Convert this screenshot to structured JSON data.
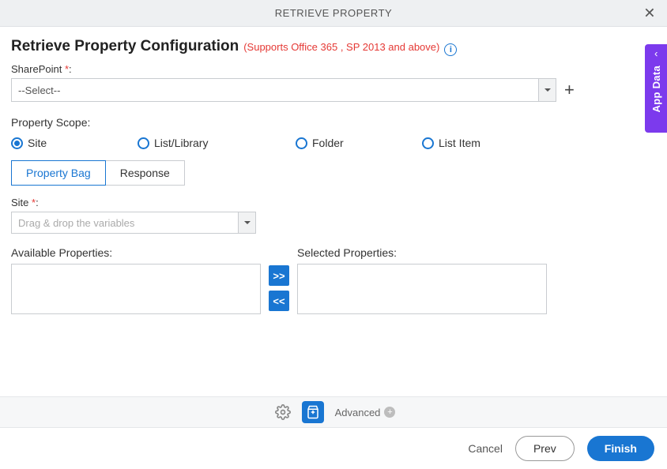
{
  "titleBar": {
    "title": "RETRIEVE PROPERTY"
  },
  "heading": {
    "main": "Retrieve Property Configuration",
    "note": "(Supports Office 365 , SP 2013 and above)"
  },
  "sharepoint": {
    "label": "SharePoint",
    "selected": "--Select--"
  },
  "scope": {
    "label": "Property Scope:",
    "options": [
      "Site",
      "List/Library",
      "Folder",
      "List Item"
    ],
    "selected": "Site"
  },
  "tabs": {
    "items": [
      "Property Bag",
      "Response"
    ],
    "active": "Property Bag"
  },
  "site": {
    "label": "Site",
    "placeholder": "Drag & drop the variables"
  },
  "dual": {
    "availableLabel": "Available Properties:",
    "selectedLabel": "Selected Properties:",
    "addAll": ">>",
    "removeAll": "<<"
  },
  "toolbar": {
    "advanced": "Advanced"
  },
  "footer": {
    "cancel": "Cancel",
    "prev": "Prev",
    "finish": "Finish"
  },
  "sidePanel": {
    "label": "App Data"
  }
}
